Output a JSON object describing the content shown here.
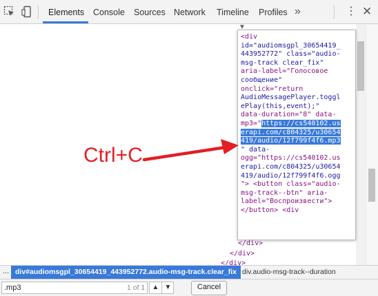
{
  "toolbar": {
    "tabs": [
      "Elements",
      "Console",
      "Sources",
      "Network",
      "Timeline",
      "Profiles"
    ],
    "active_tab": "Elements",
    "more_glyph": "»",
    "kebab_glyph": "⋮",
    "close_glyph": "✕"
  },
  "code_panel": {
    "lines": [
      "<div",
      "id=\"audiomsgpl_30654419_",
      "443952772\" class=\"audio-",
      "msg-track clear_fix\"",
      "aria-label=\"Голосовое",
      "сообщение\"",
      "onclick=\"return",
      "AudioMessagePlayer.toggl",
      "ePlay(this,event);\"",
      "data-duration=\"8\" data-",
      "mp3=\"https://cs540102.us",
      "erapi.com/c804325/u30654",
      "419/audio/12f799f4f6.mp3",
      "\" data-",
      "ogg=\"https://cs540102.us",
      "erapi.com/c804325/u30654",
      "419/audio/12f799f4f6.ogg",
      "\"> <button class=\"audio-",
      "msg-track--btn\" aria-",
      "label=\"Воспроизвести\">",
      "</button> <div"
    ],
    "tail_lines": [
      "</div>",
      "</div>",
      "</div>"
    ]
  },
  "annotation": {
    "label": "Ctrl+C",
    "color": "#e31e24"
  },
  "breadcrumb": {
    "dots": "...",
    "active_item": "div#audiomsgpl_30654419_443952772.audio-msg-track.clear_fix",
    "next_item": "div.audio-msg-track--duration"
  },
  "search": {
    "value": ".mp3",
    "match_count": "1 of 1",
    "up_glyph": "▲",
    "down_glyph": "▼",
    "cancel_label": "Cancel"
  },
  "colors": {
    "accent": "#3879d9",
    "tag": "#881280",
    "selection_text": "#ffffff"
  }
}
